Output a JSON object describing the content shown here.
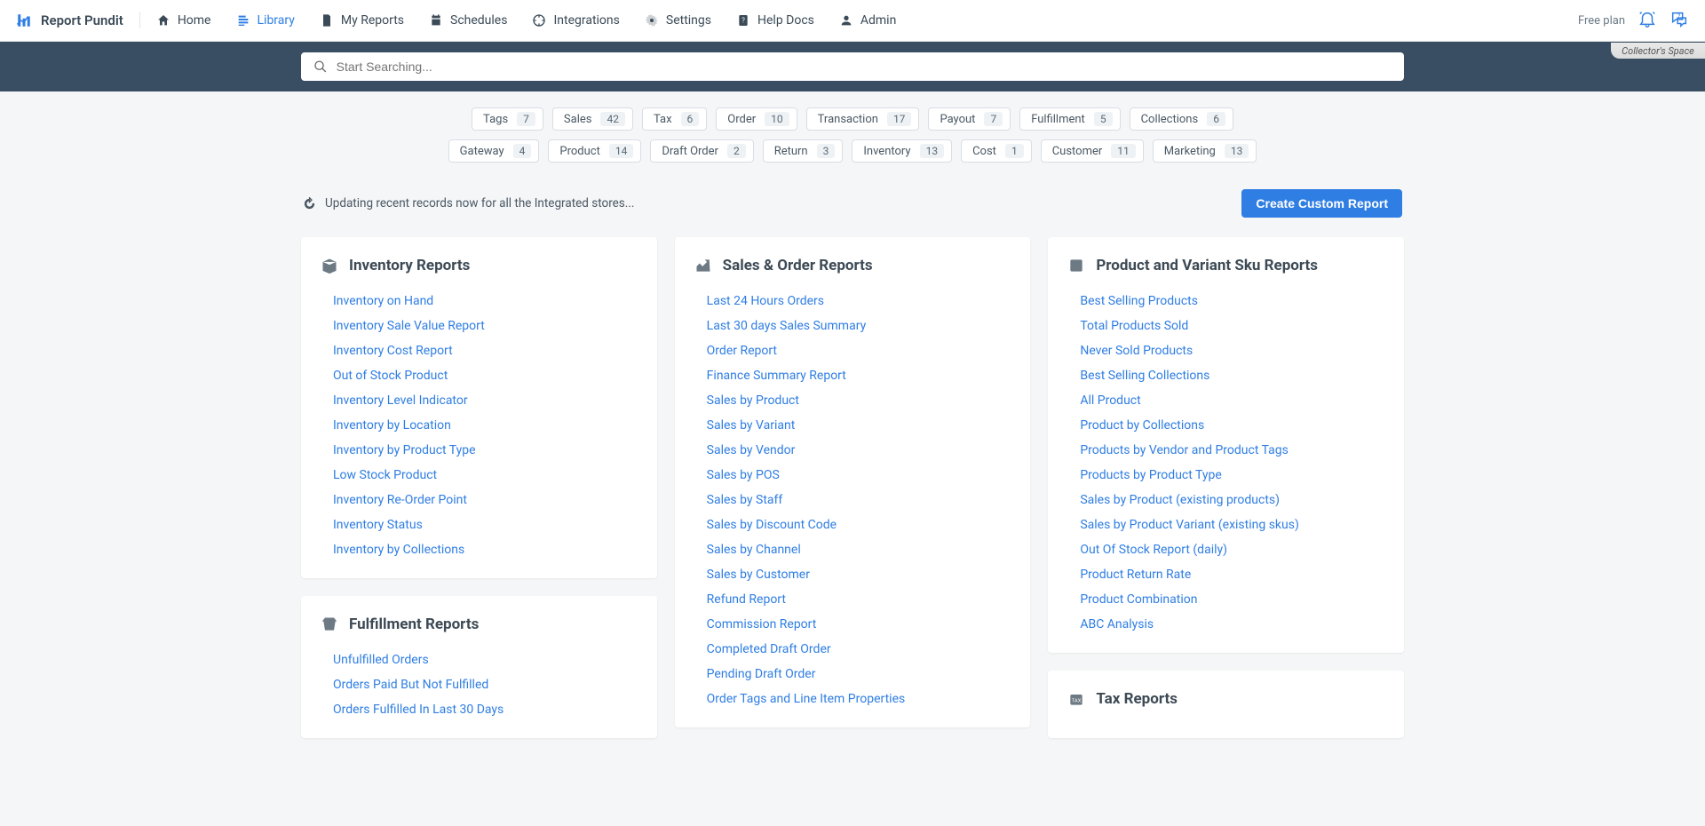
{
  "brand": "Report Pundit",
  "nav": {
    "home": "Home",
    "library": "Library",
    "my_reports": "My Reports",
    "schedules": "Schedules",
    "integrations": "Integrations",
    "settings": "Settings",
    "help_docs": "Help Docs",
    "admin": "Admin"
  },
  "plan": "Free plan",
  "store_name": "Collector's Space",
  "search": {
    "placeholder": "Start Searching..."
  },
  "filters_row1": [
    {
      "label": "Tags",
      "count": "7"
    },
    {
      "label": "Sales",
      "count": "42"
    },
    {
      "label": "Tax",
      "count": "6"
    },
    {
      "label": "Order",
      "count": "10"
    },
    {
      "label": "Transaction",
      "count": "17"
    },
    {
      "label": "Payout",
      "count": "7"
    },
    {
      "label": "Fulfillment",
      "count": "5"
    },
    {
      "label": "Collections",
      "count": "6"
    }
  ],
  "filters_row2": [
    {
      "label": "Gateway",
      "count": "4"
    },
    {
      "label": "Product",
      "count": "14"
    },
    {
      "label": "Draft Order",
      "count": "2"
    },
    {
      "label": "Return",
      "count": "3"
    },
    {
      "label": "Inventory",
      "count": "13"
    },
    {
      "label": "Cost",
      "count": "1"
    },
    {
      "label": "Customer",
      "count": "11"
    },
    {
      "label": "Marketing",
      "count": "13"
    }
  ],
  "status_message": "Updating recent records now for all the Integrated stores...",
  "create_button": "Create Custom Report",
  "cards": {
    "inventory": {
      "title": "Inventory Reports",
      "items": [
        "Inventory on Hand",
        "Inventory Sale Value Report",
        "Inventory Cost Report",
        "Out of Stock Product",
        "Inventory Level Indicator",
        "Inventory by Location",
        "Inventory by Product Type",
        "Low Stock Product",
        "Inventory Re-Order Point",
        "Inventory Status",
        "Inventory by Collections"
      ]
    },
    "fulfillment": {
      "title": "Fulfillment Reports",
      "items": [
        "Unfulfilled Orders",
        "Orders Paid But Not Fulfilled",
        "Orders Fulfilled In Last 30 Days"
      ]
    },
    "sales": {
      "title": "Sales & Order Reports",
      "items": [
        "Last 24 Hours Orders",
        "Last 30 days Sales Summary",
        "Order Report",
        "Finance Summary Report",
        "Sales by Product",
        "Sales by Variant",
        "Sales by Vendor",
        "Sales by POS",
        "Sales by Staff",
        "Sales by Discount Code",
        "Sales by Channel",
        "Sales by Customer",
        "Refund Report",
        "Commission Report",
        "Completed Draft Order",
        "Pending Draft Order",
        "Order Tags and Line Item Properties"
      ]
    },
    "product": {
      "title": "Product and Variant Sku Reports",
      "items": [
        "Best Selling Products",
        "Total Products Sold",
        "Never Sold Products",
        "Best Selling Collections",
        "All Product",
        "Product by Collections",
        "Products by Vendor and Product Tags",
        "Products by Product Type",
        "Sales by Product (existing products)",
        "Sales by Product Variant (existing skus)",
        "Out Of Stock Report (daily)",
        "Product Return Rate",
        "Product Combination",
        "ABC Analysis"
      ]
    },
    "tax": {
      "title": "Tax Reports",
      "items": []
    }
  }
}
